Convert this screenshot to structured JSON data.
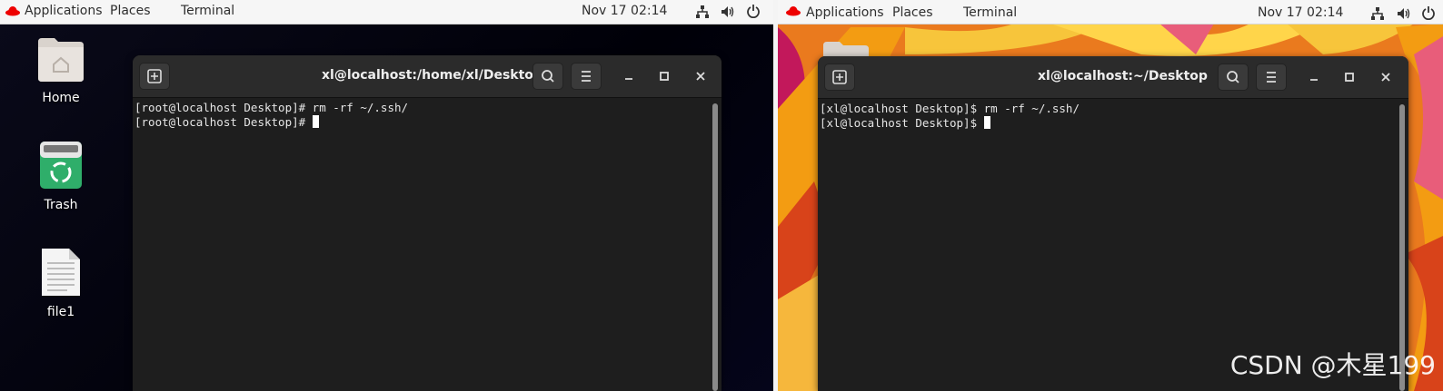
{
  "left": {
    "topbar": {
      "applications": "Applications",
      "places": "Places",
      "terminal": "Terminal",
      "datetime": "Nov 17  02:14"
    },
    "desktop": {
      "home": "Home",
      "trash": "Trash",
      "file1": "file1"
    },
    "terminal": {
      "title": "xl@localhost:/home/xl/Desktop",
      "lines": [
        "[root@localhost Desktop]# rm -rf ~/.ssh/",
        "[root@localhost Desktop]# "
      ]
    }
  },
  "right": {
    "topbar": {
      "applications": "Applications",
      "places": "Places",
      "terminal": "Terminal",
      "datetime": "Nov 17  02:14"
    },
    "terminal": {
      "title": "xl@localhost:~/Desktop",
      "lines": [
        "[xl@localhost Desktop]$ rm -rf ~/.ssh/",
        "[xl@localhost Desktop]$ "
      ]
    }
  },
  "watermark": "CSDN @木星199",
  "colors": {
    "accent_red": "#ee0000",
    "trash_green": "#2fae6a",
    "terminal_bg": "#1e1e1e",
    "header_bg": "#2b2b2b"
  }
}
